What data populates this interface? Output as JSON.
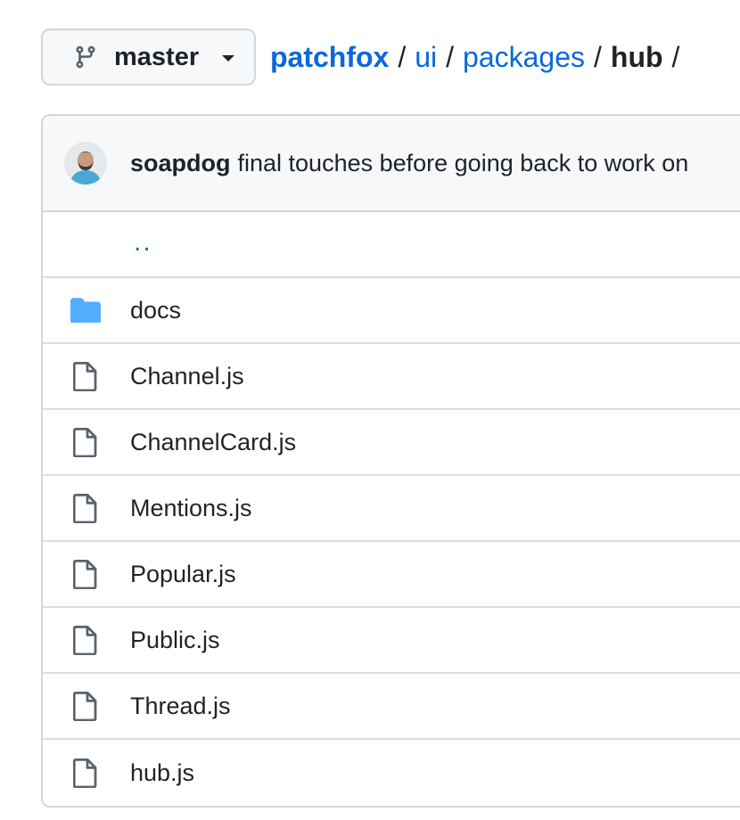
{
  "branch": {
    "label": "master",
    "icon": "git-branch-icon"
  },
  "breadcrumb": {
    "repo": "patchfox",
    "segments": [
      "ui",
      "packages"
    ],
    "current": "hub",
    "separator": "/"
  },
  "commit": {
    "author": "soapdog",
    "message": "final touches before going back to work on"
  },
  "parent_dir": {
    "label": ".."
  },
  "files": [
    {
      "name": "docs",
      "type": "folder",
      "icon": "folder-icon"
    },
    {
      "name": "Channel.js",
      "type": "file",
      "icon": "file-icon"
    },
    {
      "name": "ChannelCard.js",
      "type": "file",
      "icon": "file-icon"
    },
    {
      "name": "Mentions.js",
      "type": "file",
      "icon": "file-icon"
    },
    {
      "name": "Popular.js",
      "type": "file",
      "icon": "file-icon"
    },
    {
      "name": "Public.js",
      "type": "file",
      "icon": "file-icon"
    },
    {
      "name": "Thread.js",
      "type": "file",
      "icon": "file-icon"
    },
    {
      "name": "hub.js",
      "type": "file",
      "icon": "file-icon"
    }
  ],
  "colors": {
    "link": "#0969da",
    "folder": "#54aeff",
    "text": "#1f2328",
    "border": "#d0d7de",
    "header_bg": "#f6f8fa"
  }
}
